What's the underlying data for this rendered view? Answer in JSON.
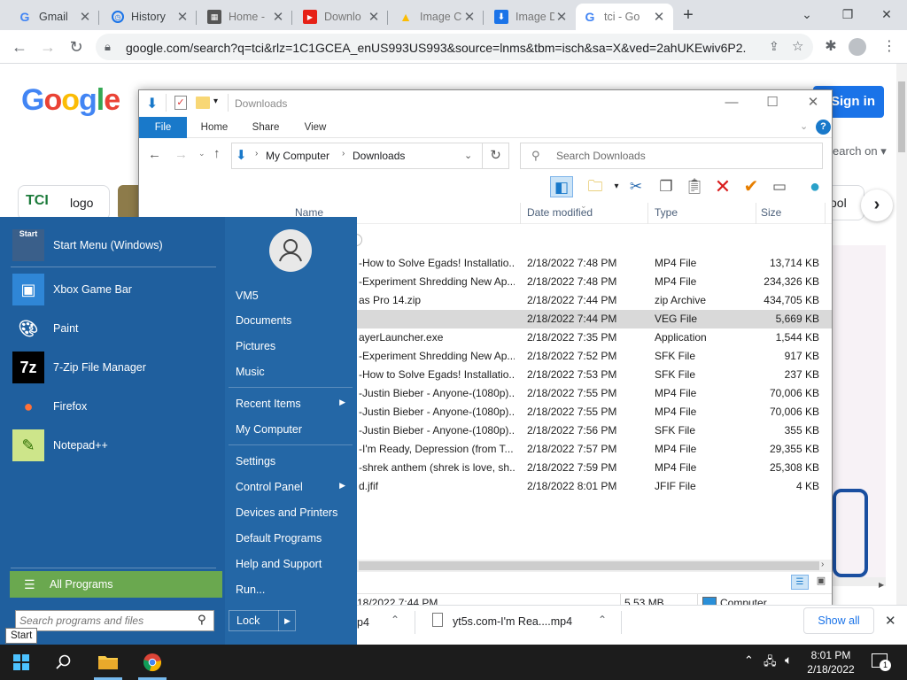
{
  "browser": {
    "tabs": [
      {
        "title": "Gmail",
        "icon": "gmail-icon"
      },
      {
        "title": "History",
        "icon": "history-icon"
      },
      {
        "title": "Home -",
        "icon": "home-page-icon"
      },
      {
        "title": "Downlo",
        "icon": "youtube-icon"
      },
      {
        "title": "Image C",
        "icon": "drive-icon"
      },
      {
        "title": "Image D",
        "icon": "download-icon"
      },
      {
        "title": "tci - Go",
        "icon": "google-icon"
      }
    ],
    "url": "google.com/search?q=tci&rlz=1C1GCEA_enUS993US993&source=lnms&tbm=isch&sa=X&ved=2ahUKEwiv6P2..."
  },
  "google_page": {
    "logo": "Google",
    "sign_in": "Sign in",
    "search_on": "earch on",
    "chips": [
      {
        "label": "logo"
      },
      {
        "label": "ool"
      }
    ],
    "show_all": "Show all"
  },
  "explorer": {
    "title": "Downloads",
    "ribbon_tabs": [
      "File",
      "Home",
      "Share",
      "View"
    ],
    "breadcrumb": [
      "My Computer",
      "Downloads"
    ],
    "search_placeholder": "Search Downloads",
    "columns": [
      "Name",
      "Date modified",
      "Type",
      "Size"
    ],
    "files": [
      {
        "name": "-How to Solve Egads! Installatio...",
        "date": "2/18/2022 7:48 PM",
        "type": "MP4 File",
        "size": "13,714 KB"
      },
      {
        "name": "-Experiment Shredding New Ap...",
        "date": "2/18/2022 7:48 PM",
        "type": "MP4 File",
        "size": "234,326 KB"
      },
      {
        "name": "as Pro 14.zip",
        "date": "2/18/2022 7:44 PM",
        "type": "zip Archive",
        "size": "434,705 KB"
      },
      {
        "name": "",
        "date": "2/18/2022 7:44 PM",
        "type": "VEG File",
        "size": "5,669 KB"
      },
      {
        "name": "ayerLauncher.exe",
        "date": "2/18/2022 7:35 PM",
        "type": "Application",
        "size": "1,544 KB"
      },
      {
        "name": "-Experiment Shredding New Ap...",
        "date": "2/18/2022 7:52 PM",
        "type": "SFK File",
        "size": "917 KB"
      },
      {
        "name": "-How to Solve Egads! Installatio...",
        "date": "2/18/2022 7:53 PM",
        "type": "SFK File",
        "size": "237 KB"
      },
      {
        "name": "-Justin Bieber - Anyone-(1080p)...",
        "date": "2/18/2022 7:55 PM",
        "type": "MP4 File",
        "size": "70,006 KB"
      },
      {
        "name": "-Justin Bieber - Anyone-(1080p)...",
        "date": "2/18/2022 7:55 PM",
        "type": "MP4 File",
        "size": "70,006 KB"
      },
      {
        "name": "-Justin Bieber - Anyone-(1080p)...",
        "date": "2/18/2022 7:56 PM",
        "type": "SFK File",
        "size": "355 KB"
      },
      {
        "name": "-I'm Ready, Depression (from T...",
        "date": "2/18/2022 7:57 PM",
        "type": "MP4 File",
        "size": "29,355 KB"
      },
      {
        "name": "-shrek anthem (shrek is love, sh...",
        "date": "2/18/2022 7:59 PM",
        "type": "MP4 File",
        "size": "25,308 KB"
      },
      {
        "name": "d.jfif",
        "date": "2/18/2022 8:01 PM",
        "type": "JFIF File",
        "size": "4 KB"
      }
    ],
    "status": {
      "date": "18/2022 7:44 PM",
      "size": "5.53 MB",
      "location": "Computer"
    }
  },
  "start_menu": {
    "apps": [
      {
        "label": "Start Menu (Windows)",
        "icon": "start-menu-icon"
      },
      {
        "label": "Xbox Game Bar",
        "icon": "xbox-icon"
      },
      {
        "label": "Paint",
        "icon": "paint-icon"
      },
      {
        "label": "7-Zip File Manager",
        "icon": "7zip-icon"
      },
      {
        "label": "Firefox",
        "icon": "firefox-icon"
      },
      {
        "label": "Notepad++",
        "icon": "notepad-plus-icon"
      }
    ],
    "user": "VM5",
    "links": [
      {
        "label": "Documents",
        "arrow": false
      },
      {
        "label": "Pictures",
        "arrow": false
      },
      {
        "label": "Music",
        "arrow": false
      },
      {
        "label": "Recent Items",
        "arrow": true
      },
      {
        "label": "My Computer",
        "arrow": false
      },
      {
        "label": "Settings",
        "arrow": false
      },
      {
        "label": "Control Panel",
        "arrow": true
      },
      {
        "label": "Devices and Printers",
        "arrow": false
      },
      {
        "label": "Default Programs",
        "arrow": false
      },
      {
        "label": "Help and Support",
        "arrow": false
      },
      {
        "label": "Run...",
        "arrow": false
      }
    ],
    "all_programs": "All Programs",
    "search_placeholder": "Search programs and files",
    "lock": "Lock",
    "tooltip": "Start"
  },
  "downloads_bar": {
    "items": [
      {
        "name": "p4"
      },
      {
        "name": "yt5s.com-I'm Rea....mp4"
      }
    ],
    "show_all": "Show all"
  },
  "taskbar": {
    "time": "8:01 PM",
    "date": "2/18/2022",
    "notification_count": "1"
  }
}
